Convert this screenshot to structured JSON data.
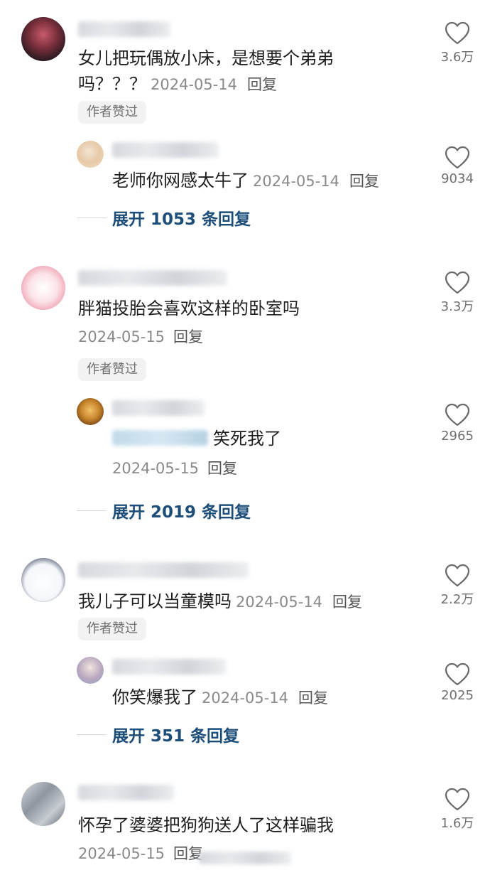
{
  "comments": [
    {
      "text_line1": "女儿把玩偶放小床，是想要个弟弟",
      "text_line2": "吗？？？",
      "date": "2024-05-14",
      "reply_label": "回复",
      "badge": "作者赞过",
      "likes": "3.6万",
      "sub": {
        "text": "老师你网感太牛了",
        "date": "2024-05-14",
        "reply_label": "回复",
        "likes": "9034"
      },
      "expand": "展开 1053 条回复"
    },
    {
      "text_line1": "胖猫投胎会喜欢这样的卧室吗",
      "date": "2024-05-15",
      "reply_label": "回复",
      "badge": "作者赞过",
      "likes": "3.3万",
      "sub": {
        "text": "笑死我了",
        "date": "2024-05-15",
        "reply_label": "回复",
        "likes": "2965"
      },
      "expand": "展开 2019 条回复"
    },
    {
      "text_line1": "我儿子可以当童模吗",
      "date": "2024-05-14",
      "reply_label": "回复",
      "badge": "作者赞过",
      "likes": "2.2万",
      "sub": {
        "text": "你笑爆我了",
        "date": "2024-05-14",
        "reply_label": "回复",
        "likes": "2025"
      },
      "expand": "展开 351 条回复"
    },
    {
      "text_line1": "怀孕了婆婆把狗狗送人了这样骗我",
      "date": "2024-05-15",
      "reply_label": "回复",
      "likes": "1.6万"
    }
  ],
  "icons": {
    "like": "heart-outline-icon"
  },
  "colors": {
    "expand_link": "#1d4e7a",
    "meta": "#8a8a8a",
    "badge_bg": "#f2f2f2"
  }
}
